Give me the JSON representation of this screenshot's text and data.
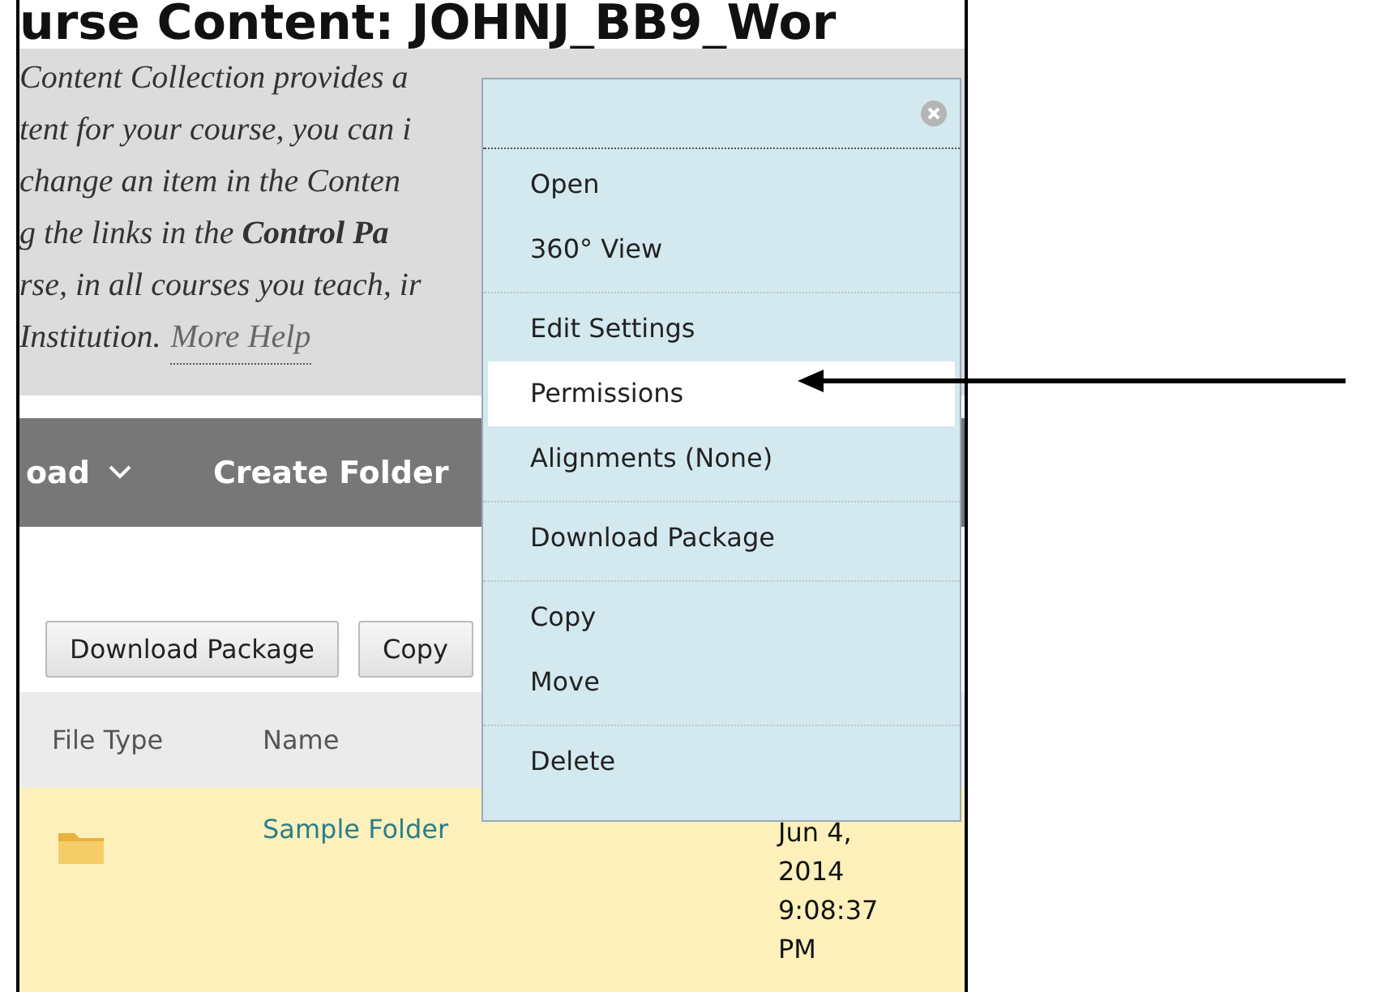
{
  "page_title": "urse Content: JOHNJ_BB9_Wor",
  "help_lines": [
    "Content Collection provides a",
    "tent for your course, you can i",
    "change an item in the Conten",
    "g the links in the **Control Pa**",
    "rse, in all courses you teach, ir"
  ],
  "help_last": {
    "text": "Institution.",
    "link": "More Help"
  },
  "toolbar": [
    {
      "label": "oad",
      "kind": "dropdown"
    },
    {
      "label": "Create Folder",
      "kind": "plain"
    }
  ],
  "buttons": [
    "Download Package",
    "Copy"
  ],
  "table": {
    "columns": [
      "File Type",
      "Name"
    ],
    "rows": [
      {
        "kind": "folder",
        "name": "Sample Folder",
        "date": "Jun 4, 2014 9:08:37 PM"
      }
    ]
  },
  "menu": {
    "groups": [
      [
        {
          "label": "Open",
          "selected": false
        },
        {
          "label": "360° View",
          "selected": false
        }
      ],
      [
        {
          "label": "Edit Settings",
          "selected": false
        },
        {
          "label": "Permissions",
          "selected": true
        },
        {
          "label": "Alignments (None)",
          "selected": false
        }
      ],
      [
        {
          "label": "Download Package",
          "selected": false
        }
      ],
      [
        {
          "label": "Copy",
          "selected": false
        },
        {
          "label": "Move",
          "selected": false
        }
      ],
      [
        {
          "label": "Delete",
          "selected": false
        }
      ]
    ]
  }
}
